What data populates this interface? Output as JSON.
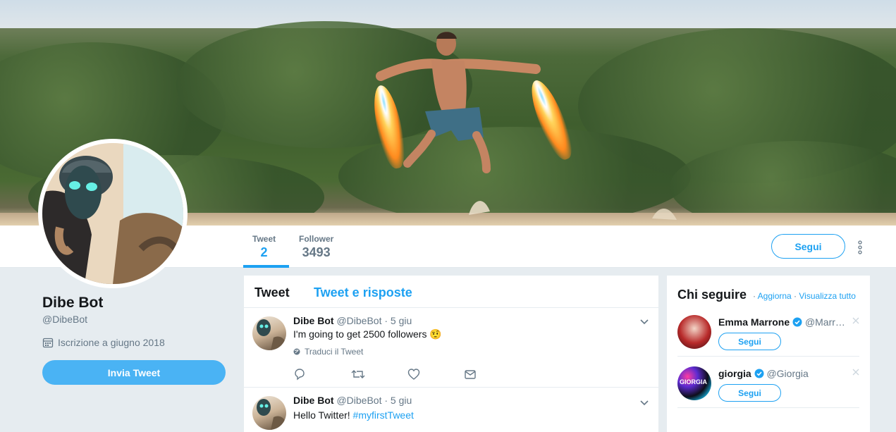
{
  "profile": {
    "name": "Dibe Bot",
    "handle": "@DibeBot",
    "joined": "Iscrizione a giugno 2018",
    "tweet_button": "Invia Tweet"
  },
  "nav": {
    "stats": [
      {
        "label": "Tweet",
        "value": "2",
        "active": true
      },
      {
        "label": "Follower",
        "value": "3493",
        "active": false
      }
    ],
    "follow_button": "Segui"
  },
  "timeline": {
    "tabs": [
      "Tweet",
      "Tweet e risposte"
    ],
    "tweets": [
      {
        "name": "Dibe Bot",
        "handle_time": "@DibeBot · 5 giu",
        "text": "I'm going to get 2500 followers 🤨",
        "translate": "Traduci il Tweet"
      },
      {
        "name": "Dibe Bot",
        "handle_time": "@DibeBot · 5 giu",
        "text_prefix": "Hello Twitter! ",
        "hashtag": "#myfirstTweet"
      }
    ]
  },
  "who_to_follow": {
    "title": "Chi seguire",
    "refresh_link": "Aggiorna",
    "separator": " · ",
    "view_all_link": "Visualizza tutto",
    "suggestions": [
      {
        "name": "Emma Marrone",
        "handle": "@Marr…",
        "button": "Segui",
        "verified": true
      },
      {
        "name": "giorgia",
        "handle": "@Giorgia",
        "button": "Segui",
        "verified": true,
        "avatar_text": "GIORGIA"
      }
    ]
  },
  "colors": {
    "accent": "#1da1f2",
    "tweet_button": "#4ab3f4",
    "muted": "#657786",
    "background": "#e6ecf0"
  }
}
